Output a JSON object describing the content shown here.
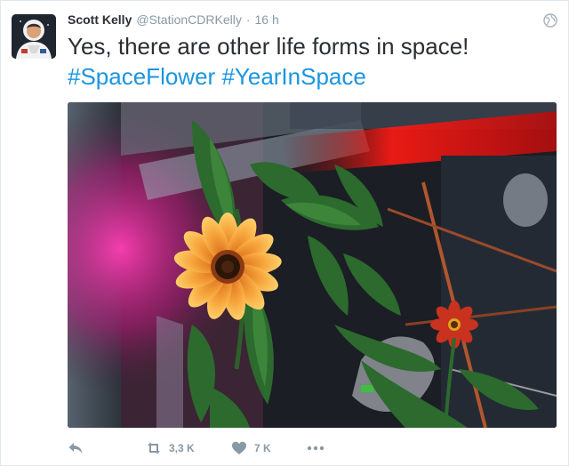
{
  "tweet": {
    "author_name": "Scott Kelly",
    "author_handle": "@StationCDRKelly",
    "separator": "·",
    "timestamp": "16 h",
    "text_line1": "Yes, there are other life forms in space!",
    "hashtags": [
      "#SpaceFlower",
      "#YearInSpace"
    ],
    "retweet_count": "3,3 K",
    "like_count": "7 K"
  },
  "icons": {
    "globe": "globe-icon",
    "reply": "reply-icon",
    "retweet": "retweet-icon",
    "like": "heart-icon",
    "more": "more-dots-icon"
  },
  "colors": {
    "text": "#292f33",
    "muted": "#8899a6",
    "link": "#1b95e0",
    "border": "#e1e8ed"
  }
}
